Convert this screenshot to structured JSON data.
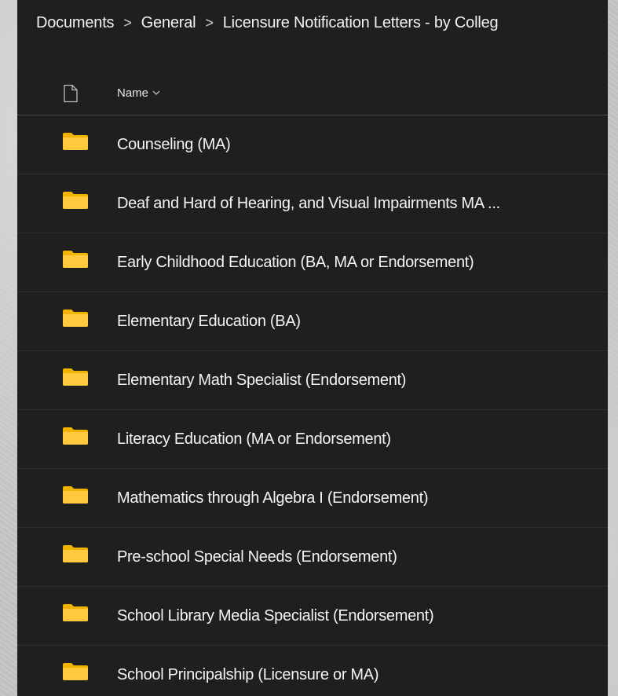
{
  "breadcrumb": {
    "items": [
      {
        "label": "Documents"
      },
      {
        "label": "General"
      },
      {
        "label": "Licensure Notification Letters - by Colleg"
      }
    ],
    "separator": ">"
  },
  "list": {
    "header": {
      "name_label": "Name",
      "file_type_icon": "document-icon",
      "sort_icon": "chevron-down-icon"
    },
    "rows": [
      {
        "label": "Counseling (MA)",
        "icon": "folder-icon"
      },
      {
        "label": "Deaf and Hard of Hearing, and Visual Impairments MA ...",
        "icon": "folder-icon"
      },
      {
        "label": "Early Childhood Education (BA, MA or Endorsement)",
        "icon": "folder-icon"
      },
      {
        "label": "Elementary Education (BA)",
        "icon": "folder-icon"
      },
      {
        "label": "Elementary Math Specialist (Endorsement)",
        "icon": "folder-icon"
      },
      {
        "label": "Literacy Education (MA or Endorsement)",
        "icon": "folder-icon"
      },
      {
        "label": "Mathematics through Algebra I (Endorsement)",
        "icon": "folder-icon"
      },
      {
        "label": "Pre-school Special Needs (Endorsement)",
        "icon": "folder-icon"
      },
      {
        "label": "School Library Media Specialist (Endorsement)",
        "icon": "folder-icon"
      },
      {
        "label": "School Principalship (Licensure or MA)",
        "icon": "folder-icon"
      }
    ]
  },
  "colors": {
    "panel_background": "#1f1f1f",
    "folder": "#ffc107",
    "text": "#f4f4f4"
  }
}
